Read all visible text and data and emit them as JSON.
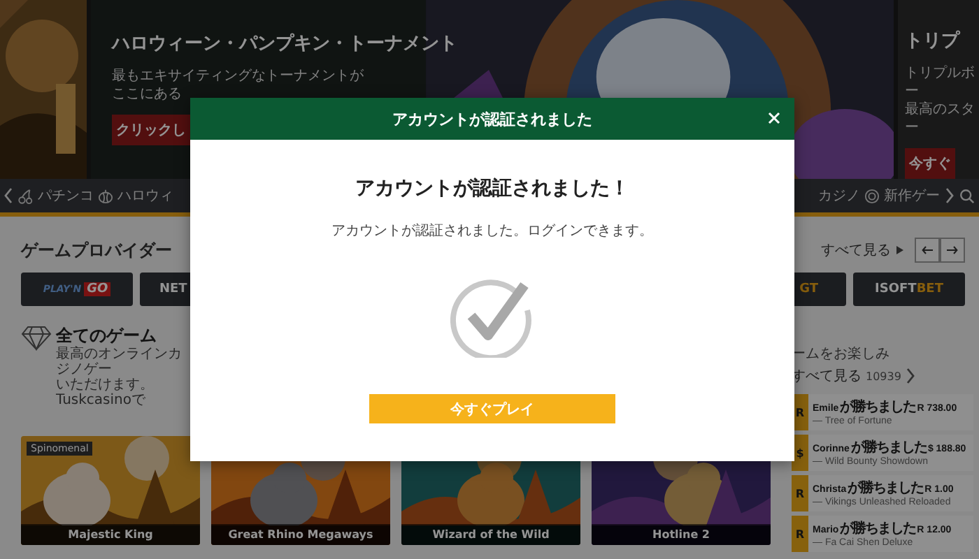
{
  "hero": {
    "main": {
      "title": "ハロウィーン・パンプキン・トーナメント",
      "subtitle_lines": [
        "最もエキサイティングなトーナメントが",
        "ここにある"
      ],
      "button": "クリックし"
    },
    "next": {
      "title": "トリプ",
      "subtitle_lines": [
        "トリプルボー",
        "最高のスター"
      ],
      "button": "今すぐ"
    }
  },
  "nav": {
    "items_left": [
      {
        "label": "パチンコ"
      },
      {
        "label": "ハロウィ"
      }
    ],
    "items_right": [
      {
        "label": "カジノ"
      },
      {
        "label": "新作ゲー"
      }
    ]
  },
  "providers": {
    "title": "ゲームプロバイダー",
    "see_all": "すべて見る",
    "left": [
      {
        "logo": [
          {
            "text": "PLAY'N",
            "accent": false
          },
          {
            "text": "GO",
            "accent": true
          }
        ]
      },
      {
        "logo": [
          {
            "text": "NET",
            "accent": false
          }
        ]
      }
    ],
    "right": [
      {
        "logo": [
          {
            "text": "GT",
            "accent": true
          }
        ]
      },
      {
        "logo": [
          {
            "text": "ISOFT",
            "accent": false
          },
          {
            "text": "BET",
            "accent": true
          }
        ]
      }
    ]
  },
  "all_games": {
    "title": "全てのゲーム",
    "description_lines": [
      "最高のオンラインカジノゲー",
      "いただけます。Tuskcasinoで"
    ],
    "description_end": "ームをお楽しみ",
    "see_all": "すべて見る",
    "count": "10939",
    "games": [
      {
        "title": "Majestic King",
        "tag": "Spinomenal"
      },
      {
        "title": "Great Rhino Megaways"
      },
      {
        "title": "Wizard of the Wild"
      },
      {
        "title": "Hotline 2"
      }
    ]
  },
  "winners": [
    {
      "currency": "R",
      "player": "Emile",
      "verb": "が勝ちました",
      "amount": "R 738.00",
      "game": "— Tree of Fortune"
    },
    {
      "currency": "$",
      "player": "Corinne",
      "verb": "が勝ちました",
      "amount": "$ 188.80",
      "game": "— Wild Bounty Showdown"
    },
    {
      "currency": "R",
      "player": "Christa",
      "verb": "が勝ちました",
      "amount": "R 1.00",
      "game": "— Vikings Unleashed Reloaded"
    },
    {
      "currency": "R",
      "player": "Mario",
      "verb": "が勝ちました",
      "amount": "R 12.00",
      "game": "— Fa Cai Shen Deluxe"
    }
  ],
  "modal": {
    "header": "アカウントが認証されました",
    "title": "アカウントが認証されました！",
    "message": "アカウントが認証されました。ログインできます。",
    "button": "今すぐプレイ"
  }
}
